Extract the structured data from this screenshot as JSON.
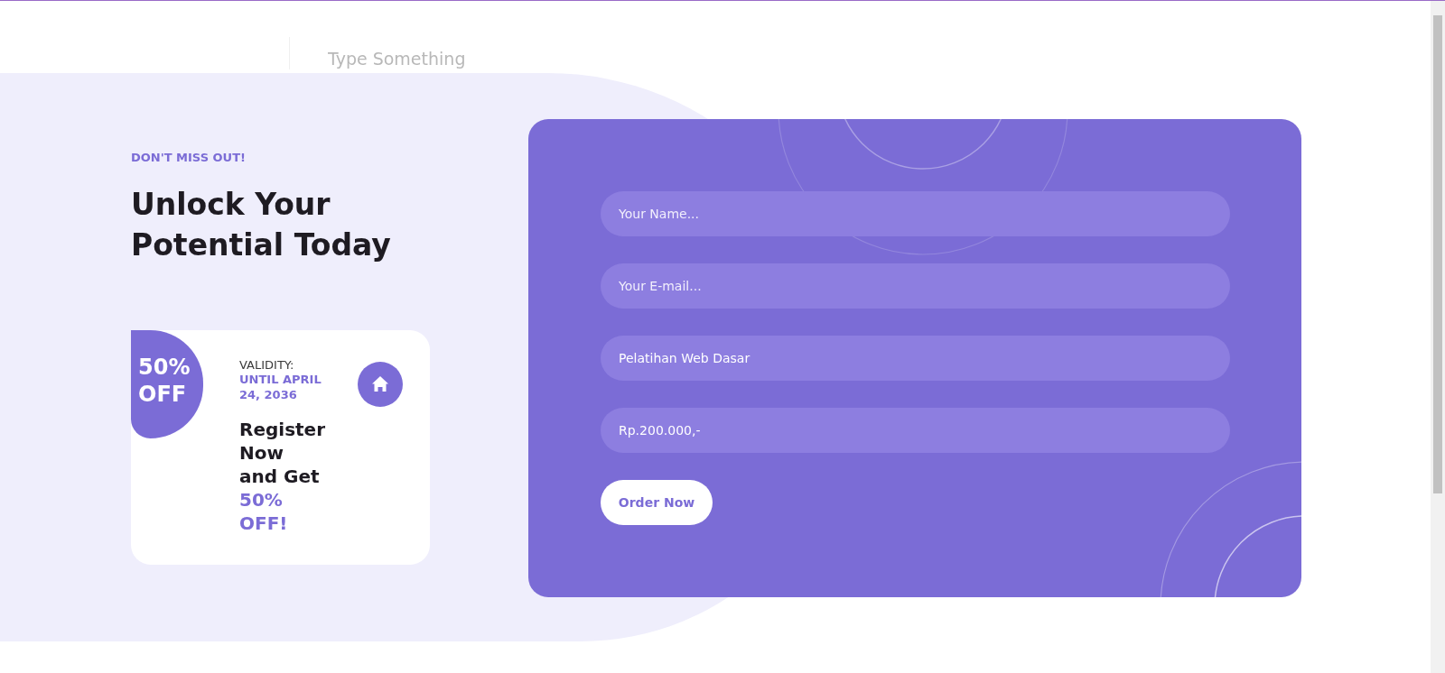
{
  "search": {
    "placeholder": "Type Something"
  },
  "promo": {
    "eyebrow": "DON'T MISS OUT!",
    "heading": "Unlock Your Potential Today",
    "coupon": {
      "badge": "50% OFF",
      "validity_label": "VALIDITY:",
      "validity_date": "UNTIL APRIL 24, 2036",
      "offer": "Register Now and Get",
      "offer_highlight": "50% OFF!"
    }
  },
  "order_form": {
    "fields": [
      {
        "placeholder": "Your Name..."
      },
      {
        "placeholder": "Your E-mail..."
      },
      {
        "value": "Pelatihan Web Dasar"
      },
      {
        "value": "Rp.200.000,-"
      }
    ],
    "submit": "Order Now"
  }
}
